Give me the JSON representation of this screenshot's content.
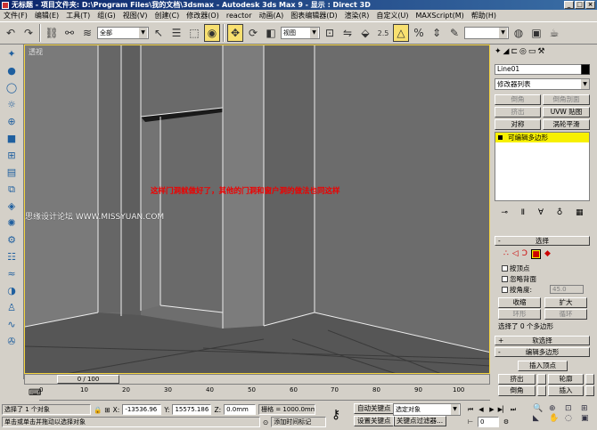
{
  "window": {
    "title": "无标题    - 项目文件夹: D:\\Program Files\\我的文档\\3dsmax    - Autodesk 3ds Max 9    - 显示 : Direct 3D",
    "btn_min": "_",
    "btn_max": "□",
    "btn_close": "×"
  },
  "menu": [
    "文件(F)",
    "编辑(E)",
    "工具(T)",
    "组(G)",
    "视图(V)",
    "创建(C)",
    "修改器(O)",
    "reactor",
    "动画(A)",
    "图表编辑器(D)",
    "渲染(R)",
    "自定义(U)",
    "MAXScript(M)",
    "帮助(H)"
  ],
  "toolbar": {
    "selection_filter": "全部",
    "ref_coord": "视图",
    "angle_snap_value": "2.5",
    "named_selection": ""
  },
  "viewport": {
    "label": "透视",
    "annotation": "这样门洞就做好了，其他的门洞和窗户洞的做法也同这样",
    "watermark": "思缘设计论坛 WWW.MISSYUAN.COM"
  },
  "command_panel": {
    "object_name": "Line01",
    "modifier_list": "修改器列表",
    "buttons": [
      "倒角",
      "倒角剖面",
      "挤出",
      "UVW 贴图",
      "对称",
      "涡轮平滑"
    ],
    "stack_item": "可编辑多边形",
    "selection_rollout": "选择",
    "by_vertex": "按顶点",
    "ignore_backfacing": "忽略背面",
    "by_angle": "按角度:",
    "angle_value": "45.0",
    "shrink": "收缩",
    "grow": "扩大",
    "ring": "环形",
    "loop": "循环",
    "selected_count": "选择了 0 个多边形",
    "soft_selection": "软选择",
    "edit_polygons": "编辑多边形",
    "insert_vertex": "插入顶点",
    "extrude": "挤出",
    "outline": "轮廓",
    "bevel": "倒角",
    "inset": "插入"
  },
  "timeline": {
    "frame_display": "0 / 100",
    "ticks": [
      "0",
      "10",
      "20",
      "30",
      "40",
      "50",
      "60",
      "70",
      "80",
      "90",
      "100"
    ]
  },
  "status": {
    "selection": "选择了 1 个对象",
    "prompt": "单击或单击并拖动以选择对象",
    "x_label": "X:",
    "x_value": "-13536.96",
    "y_label": "Y:",
    "y_value": "15575.186",
    "z_label": "Z:",
    "z_value": "0.0mm",
    "grid": "栅格 = 1000.0mm",
    "add_time_tag": "添加时间标记",
    "auto_key": "自动关键点",
    "set_key": "设置关键点",
    "key_mode": "选定对象",
    "key_filters": "关键点过滤器...",
    "current_frame": "0"
  },
  "colors": {
    "viewport_bg": "#6e6e6e",
    "active_border": "#f5d440",
    "annotation": "#e00000",
    "stack_highlight": "#f7f000"
  }
}
